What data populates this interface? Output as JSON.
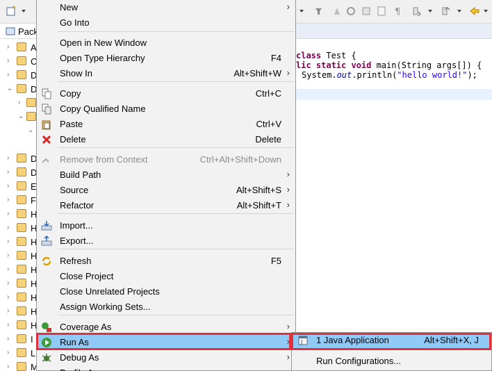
{
  "explorer": {
    "tab_label": "Pack",
    "rows": [
      {
        "label": "A",
        "chev": "›"
      },
      {
        "label": "C",
        "chev": "›"
      },
      {
        "label": "D",
        "chev": "›"
      },
      {
        "label": "D",
        "chev": "⌄"
      },
      {
        "label": "",
        "chev": "›"
      },
      {
        "label": "",
        "chev": "⌄"
      },
      {
        "label": "",
        "chev": "⌄"
      },
      {
        "label": "D",
        "chev": "›"
      },
      {
        "label": "D",
        "chev": "›"
      },
      {
        "label": "E",
        "chev": "›"
      },
      {
        "label": "F",
        "chev": "›"
      },
      {
        "label": "H",
        "chev": "›"
      },
      {
        "label": "H",
        "chev": "›"
      },
      {
        "label": "H",
        "chev": "›"
      },
      {
        "label": "H",
        "chev": "›"
      },
      {
        "label": "H",
        "chev": "›"
      },
      {
        "label": "H",
        "chev": "›"
      },
      {
        "label": "H",
        "chev": "›"
      },
      {
        "label": "H",
        "chev": "›"
      },
      {
        "label": "H",
        "chev": "›"
      },
      {
        "label": "I",
        "chev": "›"
      },
      {
        "label": "L",
        "chev": "›"
      },
      {
        "label": "M",
        "chev": "›"
      }
    ]
  },
  "editor": {
    "line1_kw": "class",
    "line1_rest": " Test {",
    "line2_kw1": "lic static void",
    "line2_rest": " main(String args[]) {",
    "line3_a": "System.",
    "line3_out": "out",
    "line3_b": ".println(",
    "line3_str": "\"hello world!\"",
    "line3_c": ");"
  },
  "menu": {
    "items": [
      {
        "label": "New",
        "shortcut": "",
        "submenu": true
      },
      {
        "label": "Go Into",
        "shortcut": "",
        "submenu": false
      },
      {
        "label": "Open in New Window",
        "shortcut": "",
        "submenu": false
      },
      {
        "label": "Open Type Hierarchy",
        "shortcut": "F4",
        "submenu": false
      },
      {
        "label": "Show In",
        "shortcut": "Alt+Shift+W",
        "submenu": true
      },
      {
        "label": "Copy",
        "shortcut": "Ctrl+C",
        "submenu": false
      },
      {
        "label": "Copy Qualified Name",
        "shortcut": "",
        "submenu": false
      },
      {
        "label": "Paste",
        "shortcut": "Ctrl+V",
        "submenu": false
      },
      {
        "label": "Delete",
        "shortcut": "Delete",
        "submenu": false
      },
      {
        "label": "Remove from Context",
        "shortcut": "Ctrl+Alt+Shift+Down",
        "submenu": false
      },
      {
        "label": "Build Path",
        "shortcut": "",
        "submenu": true
      },
      {
        "label": "Source",
        "shortcut": "Alt+Shift+S",
        "submenu": true
      },
      {
        "label": "Refactor",
        "shortcut": "Alt+Shift+T",
        "submenu": true
      },
      {
        "label": "Import...",
        "shortcut": "",
        "submenu": false
      },
      {
        "label": "Export...",
        "shortcut": "",
        "submenu": false
      },
      {
        "label": "Refresh",
        "shortcut": "F5",
        "submenu": false
      },
      {
        "label": "Close Project",
        "shortcut": "",
        "submenu": false
      },
      {
        "label": "Close Unrelated Projects",
        "shortcut": "",
        "submenu": false
      },
      {
        "label": "Assign Working Sets...",
        "shortcut": "",
        "submenu": false
      },
      {
        "label": "Coverage As",
        "shortcut": "",
        "submenu": true
      },
      {
        "label": "Run As",
        "shortcut": "",
        "submenu": true
      },
      {
        "label": "Debug As",
        "shortcut": "",
        "submenu": true
      },
      {
        "label": "Profile As",
        "shortcut": "",
        "submenu": true
      }
    ],
    "submenu_arrow": "›"
  },
  "run_as_submenu": {
    "items": [
      {
        "label": "1 Java Application",
        "shortcut": "Alt+Shift+X, J"
      },
      {
        "label": "Run Configurations...",
        "shortcut": ""
      }
    ]
  },
  "colors": {
    "highlight": "#91c9f7",
    "red_outline": "#e0323c"
  }
}
